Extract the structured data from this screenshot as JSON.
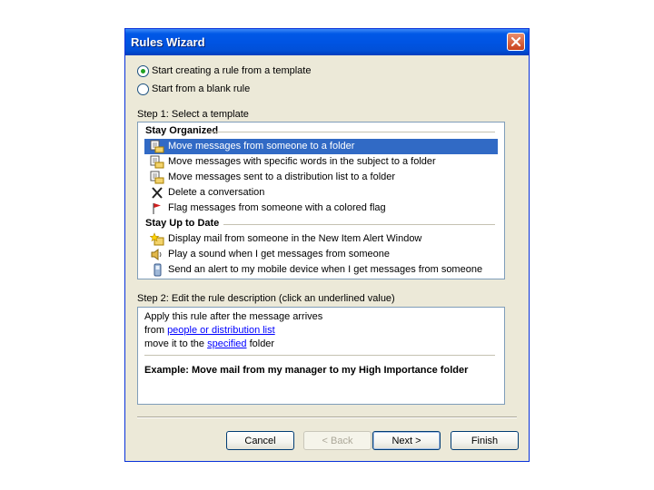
{
  "window": {
    "title": "Rules Wizard"
  },
  "mode_options": [
    {
      "label": "Start creating a rule from a template",
      "checked": true
    },
    {
      "label": "Start from a blank rule",
      "checked": false
    }
  ],
  "step1": {
    "label": "Step 1: Select a template",
    "groups": [
      {
        "header": "Stay Organized",
        "items": [
          {
            "label": "Move messages from someone to a folder",
            "icon": "move-folder-icon",
            "selected": true
          },
          {
            "label": "Move messages with specific words in the subject to a folder",
            "icon": "move-folder-icon",
            "selected": false
          },
          {
            "label": "Move messages sent to a distribution list to a folder",
            "icon": "move-folder-icon",
            "selected": false
          },
          {
            "label": "Delete a conversation",
            "icon": "delete-x-icon",
            "selected": false
          },
          {
            "label": "Flag messages from someone with a colored flag",
            "icon": "flag-icon",
            "selected": false
          }
        ]
      },
      {
        "header": "Stay Up to Date",
        "items": [
          {
            "label": "Display mail from someone in the New Item Alert Window",
            "icon": "alert-star-icon",
            "selected": false
          },
          {
            "label": "Play a sound when I get messages from someone",
            "icon": "speaker-icon",
            "selected": false
          },
          {
            "label": "Send an alert to my mobile device when I get messages from someone",
            "icon": "mobile-device-icon",
            "selected": false
          }
        ]
      }
    ]
  },
  "step2": {
    "label": "Step 2: Edit the rule description (click an underlined value)",
    "line1": "Apply this rule after the message arrives",
    "line2_prefix": "from ",
    "line2_link": "people or distribution list",
    "line3_prefix": "move it to the ",
    "line3_link": "specified",
    "line3_suffix": " folder",
    "example": "Example: Move mail from my manager to my High Importance folder"
  },
  "buttons": {
    "cancel": "Cancel",
    "back": "< Back",
    "next": "Next >",
    "finish": "Finish"
  },
  "colors": {
    "titlebar": "#0054e3",
    "selection": "#316ac5",
    "dialog_bg": "#ece9d8",
    "link": "#0000ff"
  }
}
